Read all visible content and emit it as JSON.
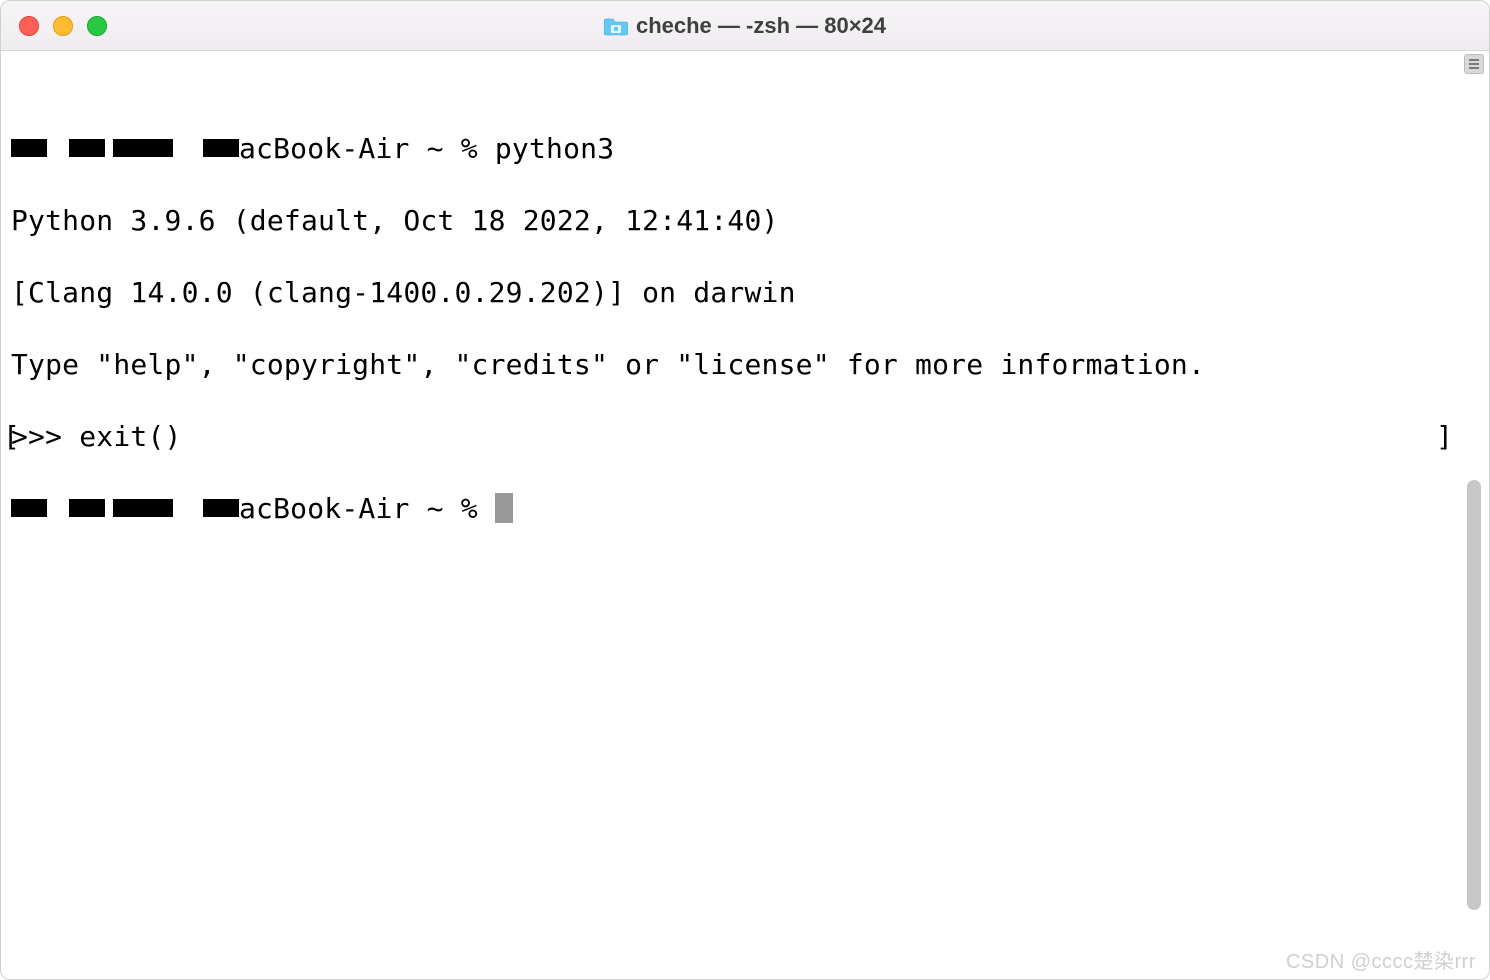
{
  "titlebar": {
    "title": "cheche — -zsh — 80×24"
  },
  "terminal": {
    "lines": {
      "l0_suffix": "acBook-Air ~ % python3",
      "l1": "Python 3.9.6 (default, Oct 18 2022, 12:41:40)",
      "l2": "[Clang 14.0.0 (clang-1400.0.29.202)] on darwin",
      "l3": "Type \"help\", \"copyright\", \"credits\" or \"license\" for more information.",
      "l4": ">>> exit()",
      "l5_suffix": "acBook-Air ~ % "
    },
    "bracket_left": "[",
    "bracket_right": "]"
  },
  "watermark": "CSDN @cccc楚染rrr"
}
